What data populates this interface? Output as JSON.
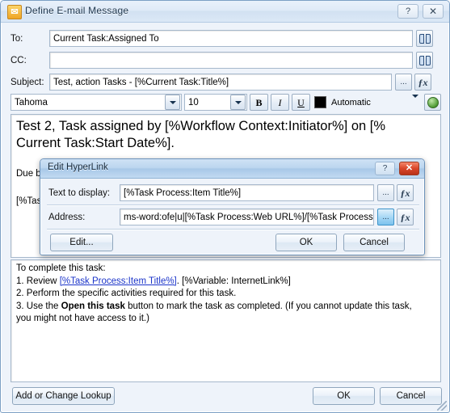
{
  "main_window": {
    "title": "Define E-mail Message",
    "icon": "email-message-icon",
    "help_label": "?",
    "close_label": "✕",
    "fields": {
      "to": {
        "label": "To:",
        "value": "Current Task:Assigned To",
        "picker_icon": "address-book-icon"
      },
      "cc": {
        "label": "CC:",
        "value": "",
        "picker_icon": "address-book-icon"
      },
      "subject": {
        "label": "Subject:",
        "value": "Test, action Tasks - [%Current Task:Title%]",
        "ellipsis_label": "...",
        "fx_label": "ƒx"
      }
    },
    "toolbar": {
      "font_name": "Tahoma",
      "font_size": "10",
      "bold_label": "B",
      "italic_label": "I",
      "underline_label": "U",
      "color_swatch": "#000000",
      "color_label": "Automatic",
      "hyperlink_icon": "globe-hyperlink-icon"
    },
    "body_top": {
      "line1": "Test 2, Task assigned by [%Workflow Context:Initiator%] on [%",
      "line2": "Current Task:Start Date%].",
      "line3_clipped": "Due b",
      "line4_clipped": "[%Tas"
    },
    "body_bottom": {
      "intro": "To complete this task:",
      "item1_prefix": "1. Review ",
      "item1_link": "[%Task Process:Item Title%]",
      "item1_suffix": ". [%Variable: InternetLink%]",
      "item2": "2. Perform the specific activities required for this task.",
      "item3_prefix": "3. Use the ",
      "item3_bold": "Open this task",
      "item3_suffix": " button to mark the task as completed. (If you cannot update this task,",
      "item3_line2": "you might not have access to it.)"
    },
    "footer": {
      "lookup_label": "Add or Change Lookup",
      "ok_label": "OK",
      "cancel_label": "Cancel"
    }
  },
  "hyperlink_dialog": {
    "title": "Edit HyperLink",
    "help_label": "?",
    "close_label": "✕",
    "text_to_display": {
      "label": "Text to display:",
      "value": "[%Task Process:Item Title%]",
      "ellipsis_label": "...",
      "fx_label": "ƒx"
    },
    "address": {
      "label": "Address:",
      "value": "ms-word:ofe|u|[%Task Process:Web URL%]/[%Task Process:It",
      "ellipsis_label": "...",
      "fx_label": "ƒx"
    },
    "buttons": {
      "edit_label": "Edit...",
      "ok_label": "OK",
      "cancel_label": "Cancel"
    }
  },
  "colors": {
    "window_face": "#eef3fa",
    "title_gradient_top": "#e9f1fb",
    "dialog_title_active": "#a8c8e8",
    "close_button_red": "#d9462a",
    "link_blue": "#1b34c9",
    "field_border": "#a6b8cc"
  }
}
